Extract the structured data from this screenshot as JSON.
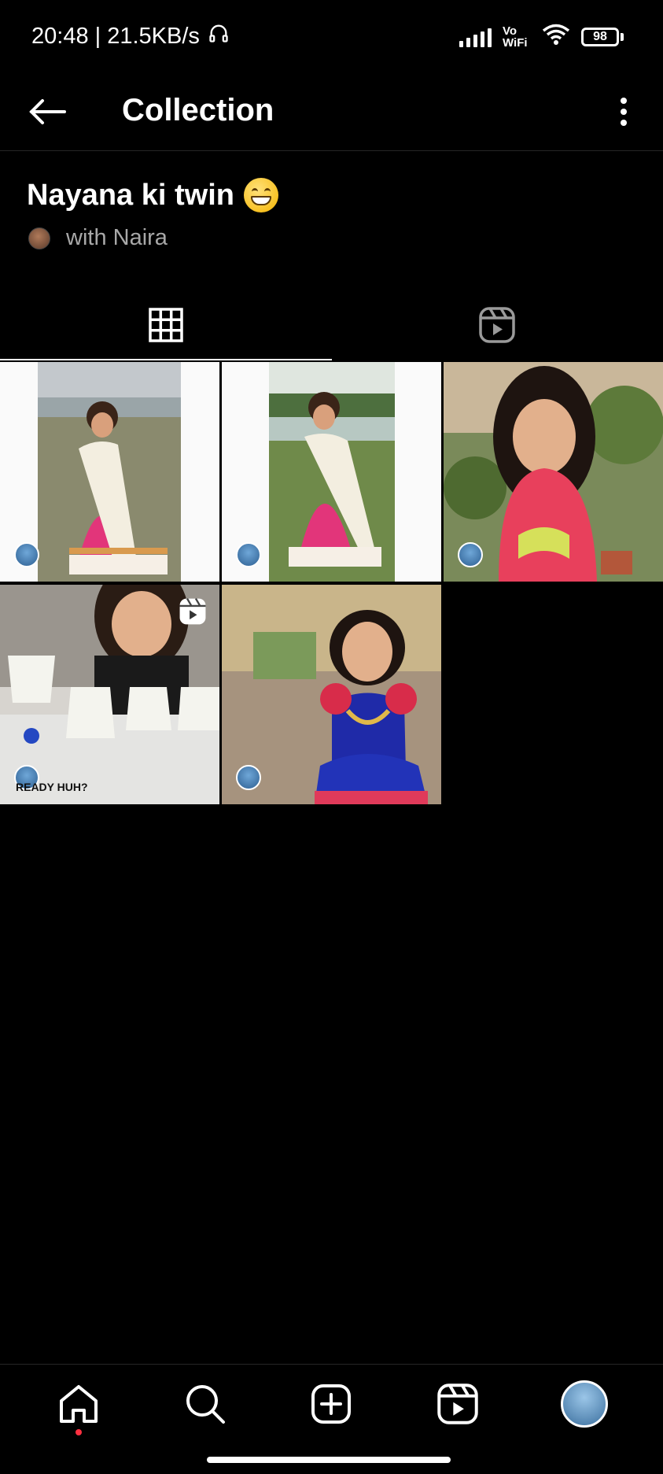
{
  "status_bar": {
    "time_speed": "20:48 | 21.5KB/s",
    "network_label": "Vo WiFi",
    "battery": "98"
  },
  "header": {
    "title": "Collection"
  },
  "collection": {
    "name": "Nayana ki twin",
    "collaborators": "with Naira"
  },
  "tabs": [
    {
      "name": "grid",
      "active": true
    },
    {
      "name": "reels",
      "active": false
    }
  ],
  "posts": [
    {
      "kind": "photo",
      "description": "girl in pink and white half-saree"
    },
    {
      "kind": "photo",
      "description": "girl in pink lehenga with white dupatta"
    },
    {
      "kind": "photo",
      "description": "girl in red dress with green bow"
    },
    {
      "kind": "reel",
      "overlay_text": "READY HUH?"
    },
    {
      "kind": "photo",
      "description": "girl in blue and red dress"
    }
  ],
  "bottom_nav": [
    "home",
    "search",
    "create",
    "reels",
    "profile"
  ],
  "colors": {
    "background": "#000000",
    "text_primary": "#ffffff",
    "text_secondary": "#a8a8a8",
    "notification_dot": "#ff3040"
  }
}
